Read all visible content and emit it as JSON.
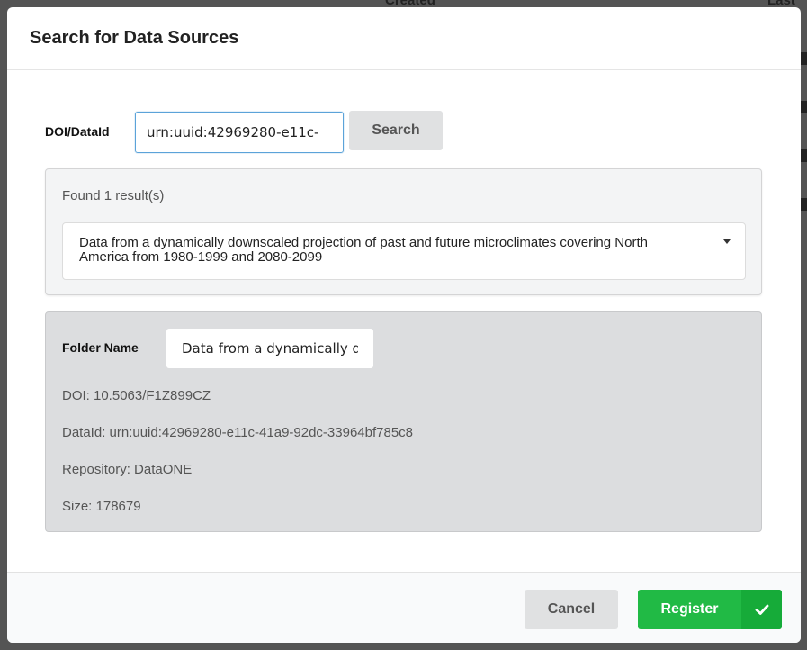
{
  "background": {
    "col_created": "Created",
    "col_last": "Last"
  },
  "modal": {
    "title": "Search for Data Sources",
    "doi_label": "DOI/DataId",
    "doi_value": "urn:uuid:42969280-e11c-",
    "search_label": "Search",
    "results": {
      "count_text": "Found 1 result(s)",
      "selected_result": "Data from a dynamically downscaled projection of past and future microclimates covering North America from 1980-1999 and 2080-2099"
    },
    "details": {
      "folder_label": "Folder Name",
      "folder_value": "Data from a dynamically downscaled projection of past and future microclimates covering North America from 1980-1999 and 2080-2099",
      "doi_line": "DOI: 10.5063/F1Z899CZ",
      "dataid_line": "DataId: urn:uuid:42969280-e11c-41a9-92dc-33964bf785c8",
      "repository_line": "Repository: DataONE",
      "size_line": "Size: 178679"
    },
    "footer": {
      "cancel_label": "Cancel",
      "register_label": "Register"
    }
  },
  "colors": {
    "primary_green": "#21ba45",
    "focus_border": "#5ba3d9",
    "neutral_button": "#e0e1e2"
  },
  "icons": {
    "dropdown": "chevron-down-icon",
    "register": "check-icon"
  }
}
